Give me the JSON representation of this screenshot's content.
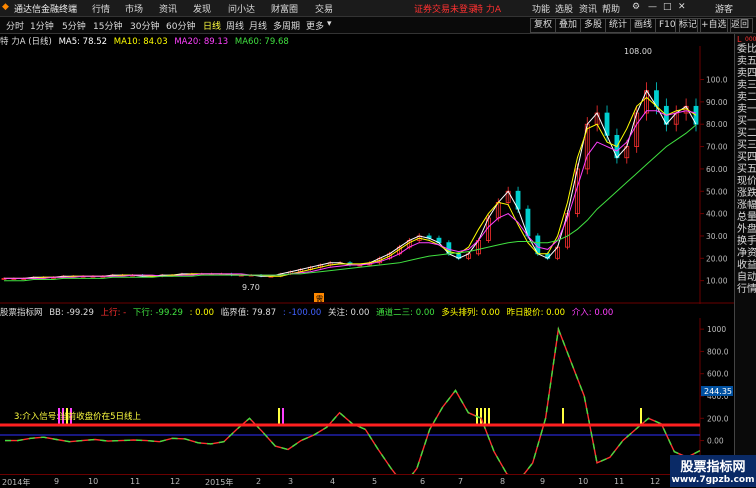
{
  "menu": {
    "app_title": "通达信金融终端",
    "items": [
      "行情",
      "市场",
      "资讯",
      "发现",
      "问小达",
      "财富圈",
      "交易"
    ],
    "login_status": "证券交易未登录",
    "stock_name": "特 力A",
    "right_items": [
      "功能",
      "选股",
      "资讯",
      "帮助",
      "游客"
    ]
  },
  "periods": {
    "items": [
      "分时",
      "1分钟",
      "5分钟",
      "15分钟",
      "30分钟",
      "60分钟",
      "日线",
      "周线",
      "月线",
      "多周期",
      "更多"
    ],
    "active": "日线",
    "right_buttons": [
      "复权",
      "叠加",
      "多股",
      "统计",
      "画线",
      "F10",
      "标记",
      "+自选",
      "返回"
    ]
  },
  "price_info": {
    "title": "特 力A (日线)",
    "ma5": "MA5: 78.52",
    "ma10": "MA10: 84.03",
    "ma20": "MA20: 89.13",
    "ma60": "MA60: 79.68"
  },
  "indicator_info": {
    "name": "股票指标网",
    "bb": "BB: -99.29",
    "up_label": "上行: -",
    "down": "下行: -99.29",
    "zero": ": 0.00",
    "critical": "临界值: 79.87",
    "neg100": ": -100.00",
    "focus": "关注: 0.00",
    "pass23": "通道二三: 0.00",
    "bull": "多头排列: 0.00",
    "prev": "昨日股价: 0.00",
    "enter": "介入: 0.00"
  },
  "annotations": {
    "max_price": "108.00",
    "min_price": "9.70",
    "signal_text": "3:介入信号:当前收盘价在5日线上",
    "current_value": "244.35",
    "badge": "需"
  },
  "right_panel": {
    "top_label": "L",
    "top_code": "000",
    "items": [
      "委比",
      "卖五",
      "卖四",
      "卖三",
      "卖二",
      "卖一",
      "买一",
      "买二",
      "买三",
      "买四",
      "买五",
      "现价",
      "涨跌",
      "涨幅",
      "总量",
      "外盘",
      "换手",
      "净资",
      "收益",
      "自动",
      "行情"
    ]
  },
  "price_scale": [
    "100.0",
    "90.00",
    "80.00",
    "70.00",
    "60.00",
    "50.00",
    "40.00",
    "30.00",
    "20.00",
    "10.00"
  ],
  "indicator_scale": [
    "1000",
    "800.0",
    "600.0",
    "400.0",
    "200.0",
    "0.00",
    "-200.0"
  ],
  "x_axis": [
    "2014年",
    "9",
    "10",
    "11",
    "12",
    "2015年",
    "2",
    "3",
    "4",
    "5",
    "6",
    "7",
    "8",
    "9",
    "10",
    "11",
    "12"
  ],
  "watermark": {
    "line1": "股票指标网",
    "line2": "www.7gpzb.com"
  },
  "colors": {
    "up": "#ff3030",
    "down": "#00d0d0",
    "ma5": "#ffffff",
    "ma10": "#ffff00",
    "ma20": "#ff40ff",
    "ma60": "#40e040",
    "accent": "#ffff40"
  },
  "chart_data": {
    "type": "line",
    "x": [
      0,
      1,
      2,
      3,
      4,
      5,
      6,
      7,
      8,
      9,
      10,
      11,
      12,
      13,
      14,
      15,
      16,
      17,
      18,
      19,
      20,
      21,
      22,
      23,
      24,
      25,
      26,
      27,
      28,
      29,
      30,
      31,
      32,
      33,
      34,
      35,
      36,
      37,
      38,
      39,
      40,
      41,
      42,
      43,
      44,
      45,
      46,
      47,
      48,
      49,
      50,
      51,
      52,
      53,
      54,
      55,
      56,
      57,
      58,
      59,
      60,
      61,
      62,
      63,
      64,
      65,
      66,
      67,
      68,
      69,
      70
    ],
    "series": [
      {
        "name": "MA5",
        "values": [
          11,
          11,
          11,
          11.5,
          11.5,
          11.5,
          12,
          12,
          12,
          12,
          12,
          12.5,
          12.5,
          12.5,
          12,
          12,
          12.5,
          12.5,
          13,
          13,
          13,
          13,
          13,
          12.5,
          12.5,
          12.5,
          12,
          12,
          13,
          14,
          15,
          16,
          17,
          18,
          18,
          17,
          17,
          18,
          20,
          22,
          25,
          28,
          30,
          29,
          27,
          22,
          20,
          22,
          28,
          38,
          45,
          50,
          42,
          30,
          22,
          20,
          25,
          40,
          60,
          80,
          85,
          75,
          65,
          70,
          85,
          95,
          88,
          80,
          85,
          88,
          80
        ]
      },
      {
        "name": "MA10",
        "values": [
          11,
          11,
          11,
          11,
          11.5,
          11.5,
          11.5,
          12,
          12,
          12,
          12,
          12,
          12.5,
          12.5,
          12.5,
          12,
          12,
          12.5,
          12.5,
          13,
          13,
          13,
          13,
          13,
          12.5,
          12.5,
          12.5,
          12,
          12,
          13,
          14,
          15,
          16,
          17,
          17.5,
          17.5,
          17.5,
          18,
          19,
          21,
          24,
          27,
          29,
          28,
          26,
          23,
          22,
          25,
          33,
          40,
          45,
          44,
          35,
          27,
          22,
          22,
          30,
          45,
          65,
          78,
          80,
          72,
          70,
          78,
          88,
          92,
          88,
          84,
          86,
          87,
          84
        ]
      },
      {
        "name": "MA20",
        "values": [
          11,
          11,
          11,
          11,
          11,
          11.5,
          11.5,
          11.5,
          12,
          12,
          12,
          12,
          12,
          12.5,
          12.5,
          12.5,
          12,
          12,
          12.5,
          12.5,
          13,
          13,
          13,
          13,
          13,
          12.5,
          12.5,
          12.5,
          12.5,
          13,
          13.5,
          14,
          15,
          16,
          16.5,
          17,
          17,
          17.5,
          18.5,
          20,
          22,
          25,
          27,
          27,
          26,
          24,
          23,
          24,
          28,
          34,
          38,
          40,
          36,
          30,
          25,
          24,
          28,
          38,
          52,
          66,
          72,
          70,
          68,
          72,
          80,
          86,
          86,
          84,
          85,
          86,
          85
        ]
      },
      {
        "name": "MA60",
        "values": [
          10,
          10,
          10,
          10.5,
          10.5,
          10.5,
          11,
          11,
          11,
          11,
          11,
          11.5,
          11.5,
          11.5,
          11.5,
          11.5,
          12,
          12,
          12,
          12,
          12.5,
          12.5,
          12.5,
          12.5,
          12.5,
          12.5,
          12.5,
          12.5,
          12.5,
          13,
          13,
          13.5,
          14,
          14.5,
          15,
          15.5,
          16,
          16.5,
          17,
          17.5,
          18,
          19,
          20,
          21,
          21.5,
          22,
          22.5,
          23,
          24,
          25,
          26,
          27,
          27.5,
          27.5,
          27,
          27,
          28,
          30,
          33,
          37,
          42,
          46,
          50,
          54,
          58,
          62,
          66,
          70,
          73,
          76,
          79.68
        ]
      }
    ],
    "ylim": [
      0,
      115
    ]
  }
}
